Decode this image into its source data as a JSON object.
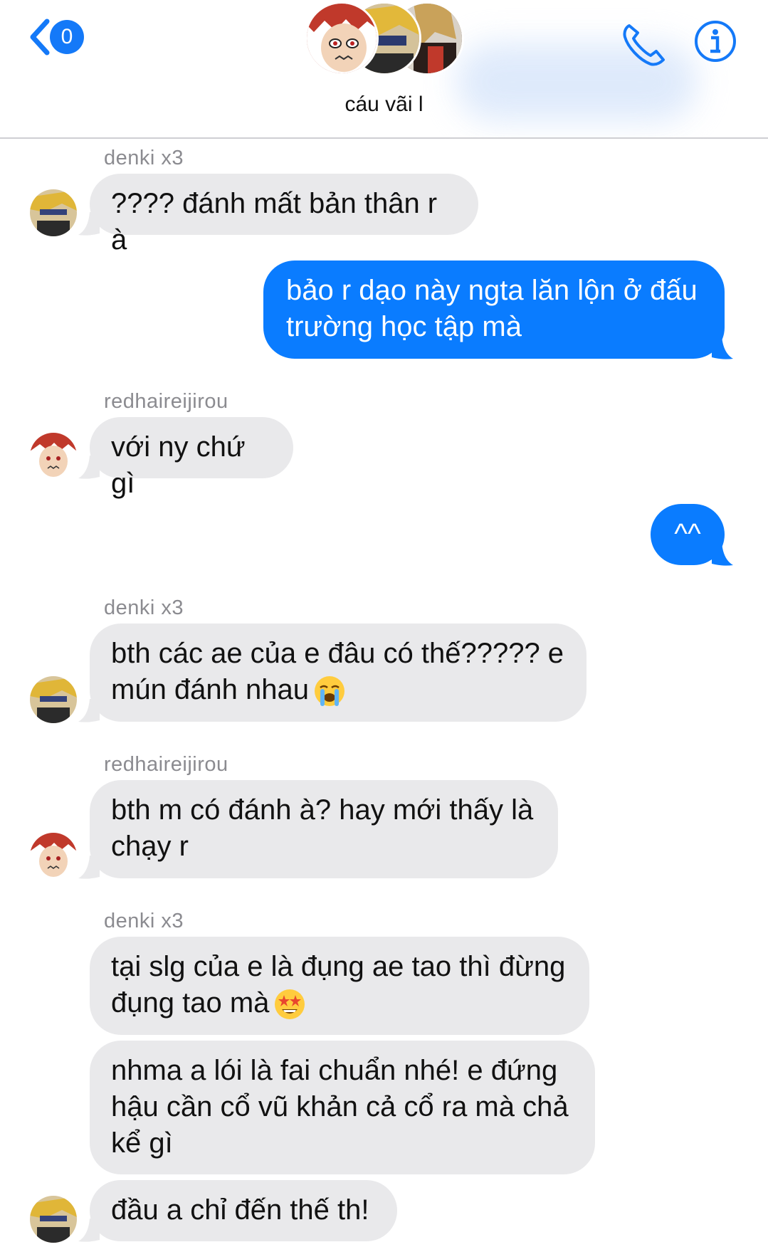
{
  "header": {
    "back_count": "0",
    "group_name": "cáu vãi l"
  },
  "messages": [
    {
      "sender": "denki x3"
    },
    {
      "text": "???? đánh mất bản thân r à"
    },
    {
      "text_line1": "bảo r dạo này ngta lăn lộn ở đấu",
      "text_line2": "trường học tập mà"
    },
    {
      "sender": "redhaireijirou"
    },
    {
      "text": "với ny chứ gì"
    },
    {
      "text": "^^"
    },
    {
      "sender": "denki x3"
    },
    {
      "text_line1": "bth các ae của e đâu có thế????? e",
      "text_line2": "mún đánh nhau",
      "emoji": "loudly-crying-face"
    },
    {
      "sender": "redhaireijirou"
    },
    {
      "text_line1": "bth m có đánh à? hay mới thấy là",
      "text_line2": "chạy r"
    },
    {
      "sender": "denki x3"
    },
    {
      "text_line1": "tại slg của e là đụng ae tao thì đừng",
      "text_line2": "đụng tao mà",
      "emoji": "star-struck-face"
    },
    {
      "text_line1": "nhma a lói là fai chuẩn nhé! e đứng",
      "text_line2": "hậu cần cổ vũ khản cả cổ ra mà chả",
      "text_line3": "kể gì"
    },
    {
      "text": "đầu a chỉ đến thế th!"
    }
  ],
  "colors": {
    "accent": "#0a7cff",
    "incoming_bubble": "#e9e9eb",
    "sender_name": "#8b8b90"
  }
}
